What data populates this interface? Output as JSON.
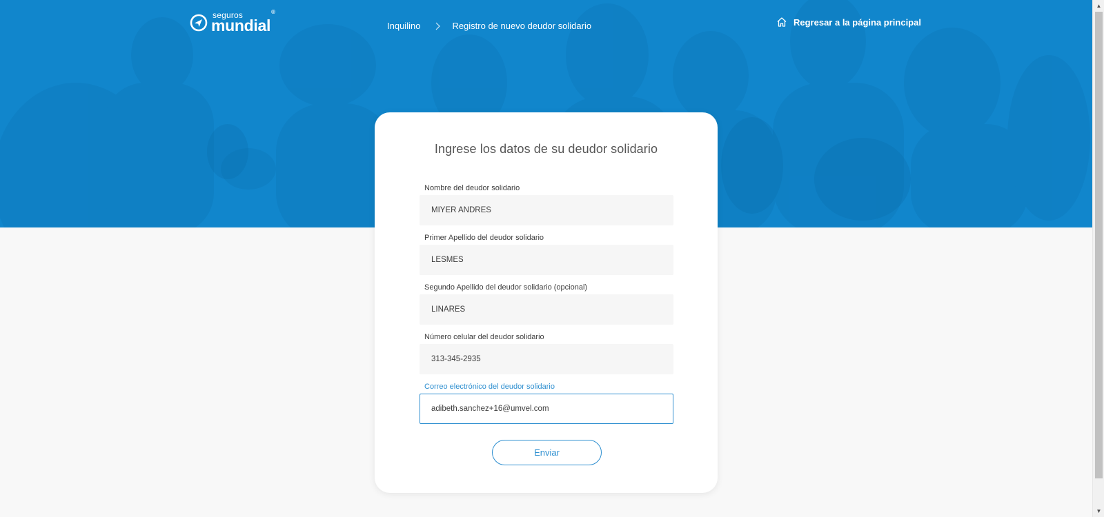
{
  "header": {
    "logo_small": "seguros",
    "logo_big": "mundial",
    "logo_reg": "®",
    "breadcrumb": [
      "Inquilino",
      "Registro de nuevo deudor solidario"
    ],
    "home_link": "Regresar a la página principal"
  },
  "form": {
    "title": "Ingrese los datos de su deudor solidario",
    "fields": [
      {
        "label": "Nombre del deudor solidario",
        "value": "MIYER ANDRES"
      },
      {
        "label": "Primer Apellido del deudor solidario",
        "value": "LESMES"
      },
      {
        "label": "Segundo Apellido del deudor solidario (opcional)",
        "value": "LINARES"
      },
      {
        "label": "Número celular del deudor solidario",
        "value": "313-345-2935"
      },
      {
        "label": "Correo electrónico del deudor solidario",
        "value": "adibeth.sanchez+16@umvel.com"
      }
    ],
    "submit_label": "Enviar"
  },
  "colors": {
    "hero_blue": "#1186cc",
    "accent": "#2e8fd0",
    "page_bg": "#f8f8f8",
    "card_bg": "#ffffff"
  },
  "icons": {
    "logo": "compass-arrow-icon",
    "breadcrumb_separator": "chevron-right-icon",
    "home": "home-icon"
  }
}
